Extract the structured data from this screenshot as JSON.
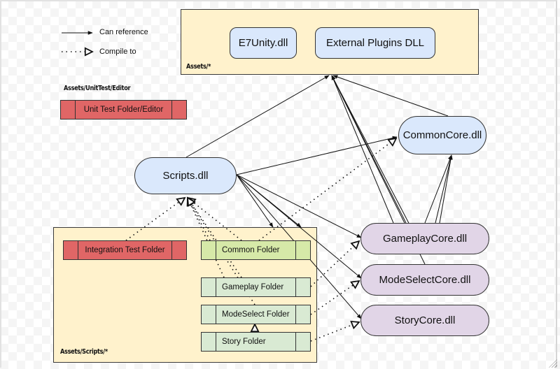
{
  "legend": {
    "solid_label": "Can reference",
    "dotted_label": "Compile to"
  },
  "containers": {
    "assets_root": {
      "label": "Assets/*"
    },
    "unit_test": {
      "label": "Assets/UnitTest/Editor"
    },
    "scripts": {
      "label": "Assets/Scripts/*"
    }
  },
  "nodes": {
    "e7unity": "E7Unity.dll",
    "external_plugins": "External Plugins DLL",
    "scripts_dll": "Scripts.dll",
    "common_core": "CommonCore.dll",
    "gameplay_core": "GameplayCore.dll",
    "modeselect_core": "ModeSelectCore.dll",
    "story_core": "StoryCore.dll"
  },
  "folders": {
    "unit_test_folder": "Unit Test Folder/Editor",
    "integration_test": "Integration Test Folder",
    "common": "Common Folder",
    "gameplay": "Gameplay Folder",
    "modeselect": "ModeSelect Folder",
    "story": "Story Folder"
  },
  "colors": {
    "container_fill": "#fff2cc",
    "dll_blue": "#dae8fc",
    "core_purple": "#e1d5e7",
    "test_red": "#e06666",
    "module_green": "#d9ead3",
    "common_green": "#d6e9a8"
  },
  "edges": [
    {
      "from": "Scripts.dll",
      "to": "Assets/*",
      "type": "can-reference"
    },
    {
      "from": "Scripts.dll",
      "to": "CommonCore.dll",
      "type": "can-reference"
    },
    {
      "from": "Scripts.dll",
      "to": "GameplayCore.dll",
      "type": "can-reference"
    },
    {
      "from": "Scripts.dll",
      "to": "ModeSelectCore.dll",
      "type": "can-reference"
    },
    {
      "from": "Scripts.dll",
      "to": "StoryCore.dll",
      "type": "can-reference"
    },
    {
      "from": "CommonCore.dll",
      "to": "Assets/*",
      "type": "can-reference"
    },
    {
      "from": "GameplayCore.dll",
      "to": "Assets/*",
      "type": "can-reference"
    },
    {
      "from": "ModeSelectCore.dll",
      "to": "Assets/*",
      "type": "can-reference"
    },
    {
      "from": "StoryCore.dll",
      "to": "Assets/*",
      "type": "can-reference"
    },
    {
      "from": "GameplayCore.dll",
      "to": "CommonCore.dll",
      "type": "can-reference"
    },
    {
      "from": "ModeSelectCore.dll",
      "to": "CommonCore.dll",
      "type": "can-reference"
    },
    {
      "from": "StoryCore.dll",
      "to": "CommonCore.dll",
      "type": "can-reference"
    },
    {
      "from": "Integration Test Folder",
      "to": "Scripts.dll",
      "type": "compile-to"
    },
    {
      "from": "Common Folder",
      "to": "CommonCore.dll",
      "type": "compile-to"
    },
    {
      "from": "Gameplay Folder",
      "to": "GameplayCore.dll",
      "type": "compile-to"
    },
    {
      "from": "ModeSelect Folder",
      "to": "ModeSelectCore.dll",
      "type": "compile-to"
    },
    {
      "from": "Story Folder",
      "to": "StoryCore.dll",
      "type": "compile-to"
    }
  ]
}
